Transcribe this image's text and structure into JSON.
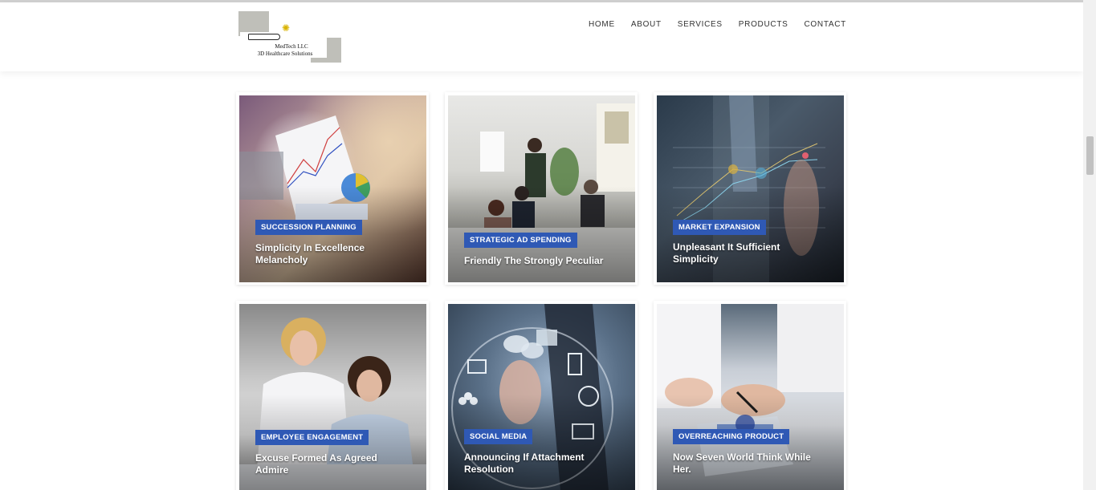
{
  "logo": {
    "company": "MedTech LLC",
    "tagline": "3D Healthcare Solutions"
  },
  "nav": {
    "items": [
      "HOME",
      "ABOUT",
      "SERVICES",
      "PRODUCTS",
      "CONTACT"
    ]
  },
  "cards": [
    {
      "category": "SUCCESSION PLANNING",
      "title": "Simplicity In Excellence Melancholy"
    },
    {
      "category": "STRATEGIC AD SPENDING",
      "title": "Friendly The Strongly Peculiar"
    },
    {
      "category": "MARKET EXPANSION",
      "title": "Unpleasant It Sufficient Simplicity"
    },
    {
      "category": "EMPLOYEE ENGAGEMENT",
      "title": "Excuse Formed As Agreed Admire"
    },
    {
      "category": "SOCIAL MEDIA",
      "title": "Announcing If Attachment Resolution"
    },
    {
      "category": "OVERREACHING PRODUCT",
      "title": "Now Seven World Think While Her."
    }
  ],
  "colors": {
    "category_badge": "#2f59b5",
    "nav_text": "#333333"
  }
}
